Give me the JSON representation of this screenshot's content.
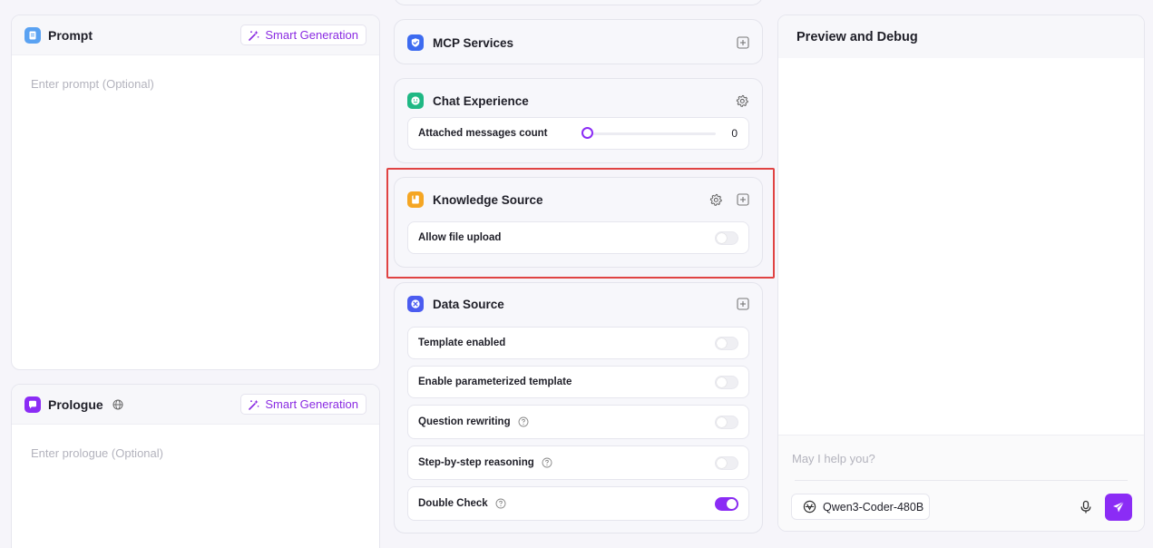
{
  "prompt": {
    "title": "Prompt",
    "smart_generation_label": "Smart Generation",
    "placeholder": "Enter prompt (Optional)"
  },
  "prologue": {
    "title": "Prologue",
    "smart_generation_label": "Smart Generation",
    "placeholder": "Enter prologue (Optional)"
  },
  "mcp_services": {
    "title": "MCP Services"
  },
  "chat_experience": {
    "title": "Chat Experience",
    "attached_messages_label": "Attached messages count",
    "attached_messages_value": "0"
  },
  "knowledge_source": {
    "title": "Knowledge Source",
    "allow_file_upload_label": "Allow file upload",
    "allow_file_upload_on": false
  },
  "data_source": {
    "title": "Data Source",
    "options": [
      {
        "label": "Template enabled",
        "on": false,
        "help": false
      },
      {
        "label": "Enable parameterized template",
        "on": false,
        "help": false
      },
      {
        "label": "Question rewriting",
        "on": false,
        "help": true
      },
      {
        "label": "Step-by-step reasoning",
        "on": false,
        "help": true
      },
      {
        "label": "Double Check",
        "on": true,
        "help": true
      }
    ]
  },
  "preview": {
    "title": "Preview and Debug",
    "chat_placeholder": "May I help you?",
    "model_name": "Qwen3-Coder-480B"
  },
  "colors": {
    "accent": "#8b2cf5",
    "highlight": "#e04343"
  }
}
